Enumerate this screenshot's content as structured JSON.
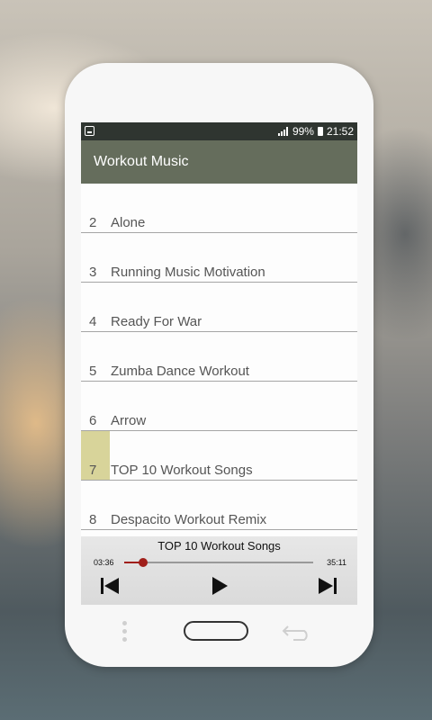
{
  "status_bar": {
    "battery_percent": "99%",
    "time": "21:52",
    "icons": [
      "notification-icon",
      "signal-icon",
      "battery-icon"
    ]
  },
  "app_bar": {
    "title": "Workout Music",
    "color": "#656d5c"
  },
  "songs": [
    {
      "number": "2",
      "title": "Alone"
    },
    {
      "number": "3",
      "title": "Running Music Motivation"
    },
    {
      "number": "4",
      "title": "Ready For War"
    },
    {
      "number": "5",
      "title": "Zumba Dance Workout"
    },
    {
      "number": "6",
      "title": "Arrow"
    },
    {
      "number": "7",
      "title": "TOP 10 Workout Songs",
      "active": true
    },
    {
      "number": "8",
      "title": "Despacito Workout Remix"
    }
  ],
  "player": {
    "now_playing": "TOP 10 Workout Songs",
    "current_time": "03:36",
    "duration": "35:11",
    "progress_fraction": 0.1,
    "accent_color": "#a01f1a",
    "controls": [
      "skip-previous-icon",
      "play-icon",
      "skip-next-icon"
    ]
  },
  "highlight_color": "#d8d49a"
}
